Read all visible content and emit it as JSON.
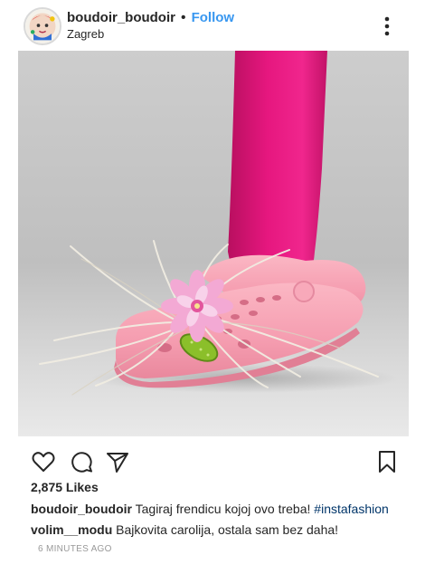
{
  "post": {
    "username": "boudoir_boudoir",
    "separator": "•",
    "follow_label": "Follow",
    "location": "Zagreb",
    "more_icon": "more-vertical-icon"
  },
  "actions": {
    "like_icon": "heart-icon",
    "comment_icon": "comment-icon",
    "share_icon": "paper-plane-icon",
    "save_icon": "bookmark-icon"
  },
  "likes": {
    "count_text": "2,875 Likes"
  },
  "caption": {
    "username": "boudoir_boudoir",
    "text": "Tagiraj frendicu kojoj ovo treba!",
    "hashtag": "#instafashion"
  },
  "comments": [
    {
      "username": "volim__modu",
      "text": "Bajkovita carolija, ostala sam bez daha!"
    }
  ],
  "timestamp": "6 MINUTES AGO",
  "colors": {
    "follow": "#3897f0",
    "hashtag": "#003569",
    "tights": "#e0157a",
    "clog": "#f59db0"
  }
}
